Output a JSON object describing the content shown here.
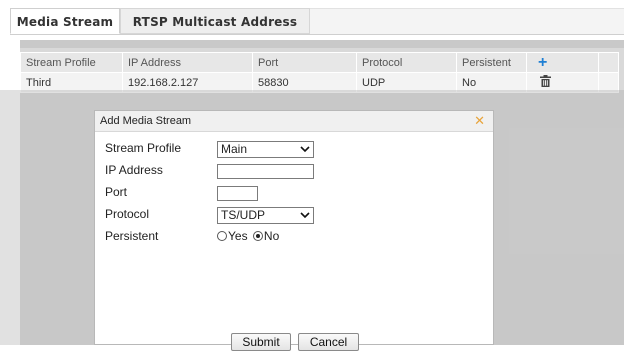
{
  "tabs": [
    {
      "label": "Media Stream",
      "active": true
    },
    {
      "label": "RTSP Multicast Address",
      "active": false
    }
  ],
  "table": {
    "columns": [
      "Stream Profile",
      "IP Address",
      "Port",
      "Protocol",
      "Persistent"
    ],
    "add_icon": "plus-icon",
    "rows": [
      {
        "stream_profile": "Third",
        "ip_address": "192.168.2.127",
        "port": "58830",
        "protocol": "UDP",
        "persistent": "No",
        "action_icon": "trash-icon"
      }
    ]
  },
  "dialog": {
    "title": "Add Media Stream",
    "close_icon": "close-icon",
    "fields": {
      "stream_profile": {
        "label": "Stream Profile",
        "value": "Main"
      },
      "ip_address": {
        "label": "IP Address",
        "value": ""
      },
      "port": {
        "label": "Port",
        "value": ""
      },
      "protocol": {
        "label": "Protocol",
        "value": "TS/UDP"
      },
      "persistent": {
        "label": "Persistent",
        "options": [
          "Yes",
          "No"
        ],
        "selected": "No"
      }
    },
    "buttons": {
      "submit": "Submit",
      "cancel": "Cancel"
    }
  },
  "colors": {
    "accent": "#1e7fd4",
    "close": "#e8a43b"
  }
}
